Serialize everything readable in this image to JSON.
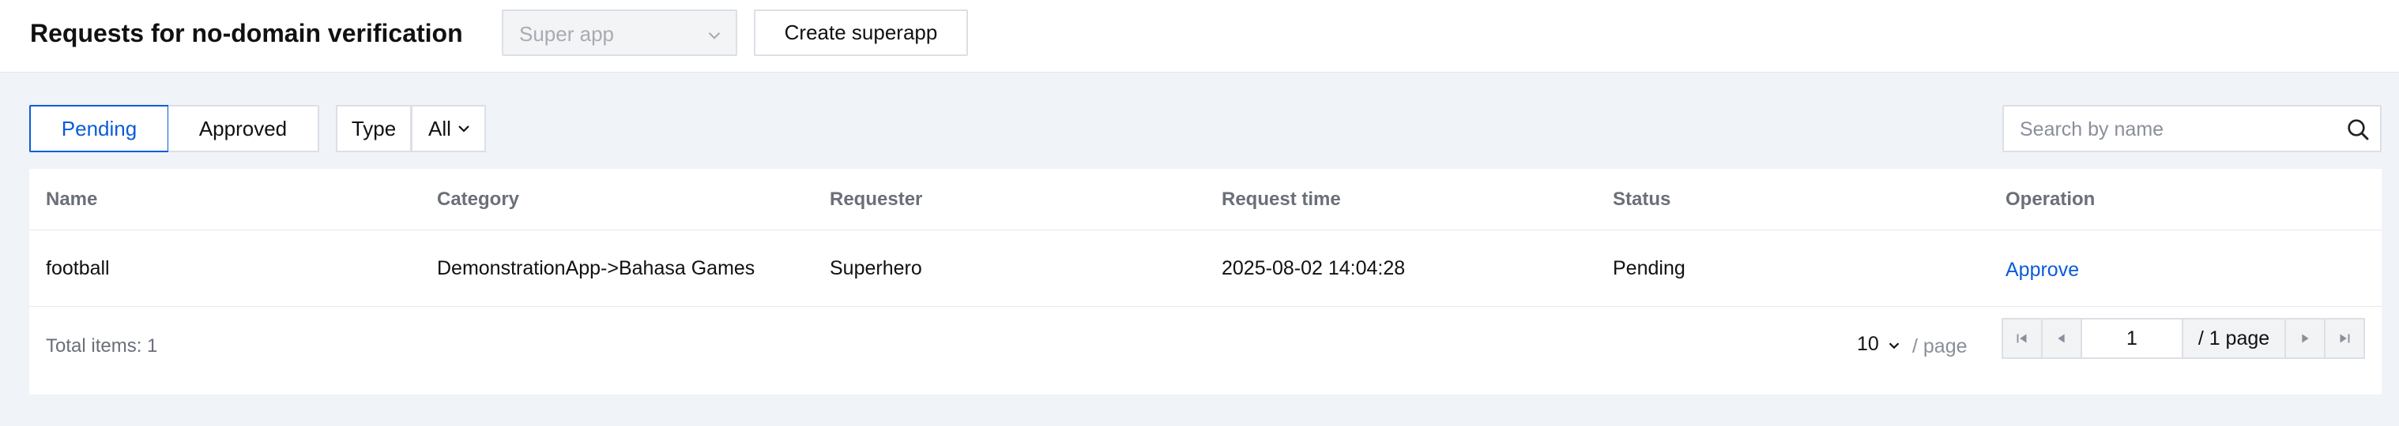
{
  "header": {
    "title": "Requests for no-domain verification",
    "app_select_placeholder": "Super app",
    "create_button": "Create superapp"
  },
  "filters": {
    "tabs": [
      {
        "label": "Pending",
        "active": true
      },
      {
        "label": "Approved",
        "active": false
      }
    ],
    "type_label": "Type",
    "type_value": "All",
    "search_placeholder": "Search by name"
  },
  "table": {
    "columns": [
      "Name",
      "Category",
      "Requester",
      "Request time",
      "Status",
      "Operation"
    ],
    "rows": [
      {
        "name": "football",
        "category": "DemonstrationApp->Bahasa Games",
        "requester": "Superhero",
        "request_time": "2025-08-02 14:04:28",
        "status": "Pending",
        "operation": "Approve"
      }
    ]
  },
  "pagination": {
    "total_text": "Total items: 1",
    "page_size": "10",
    "per_page_suffix": "/ page",
    "current_page": "1",
    "total_pages_text": "/ 1 page"
  },
  "icons": {
    "app_select": "chevron-down-icon",
    "type_select": "chevron-down-icon",
    "search": "search-icon",
    "first": "first-page-icon",
    "prev": "prev-page-icon",
    "next": "next-page-icon",
    "last": "last-page-icon"
  },
  "colors": {
    "accent": "#0a5cd8",
    "background": "#f0f3f7",
    "border": "#dcdfe6"
  }
}
